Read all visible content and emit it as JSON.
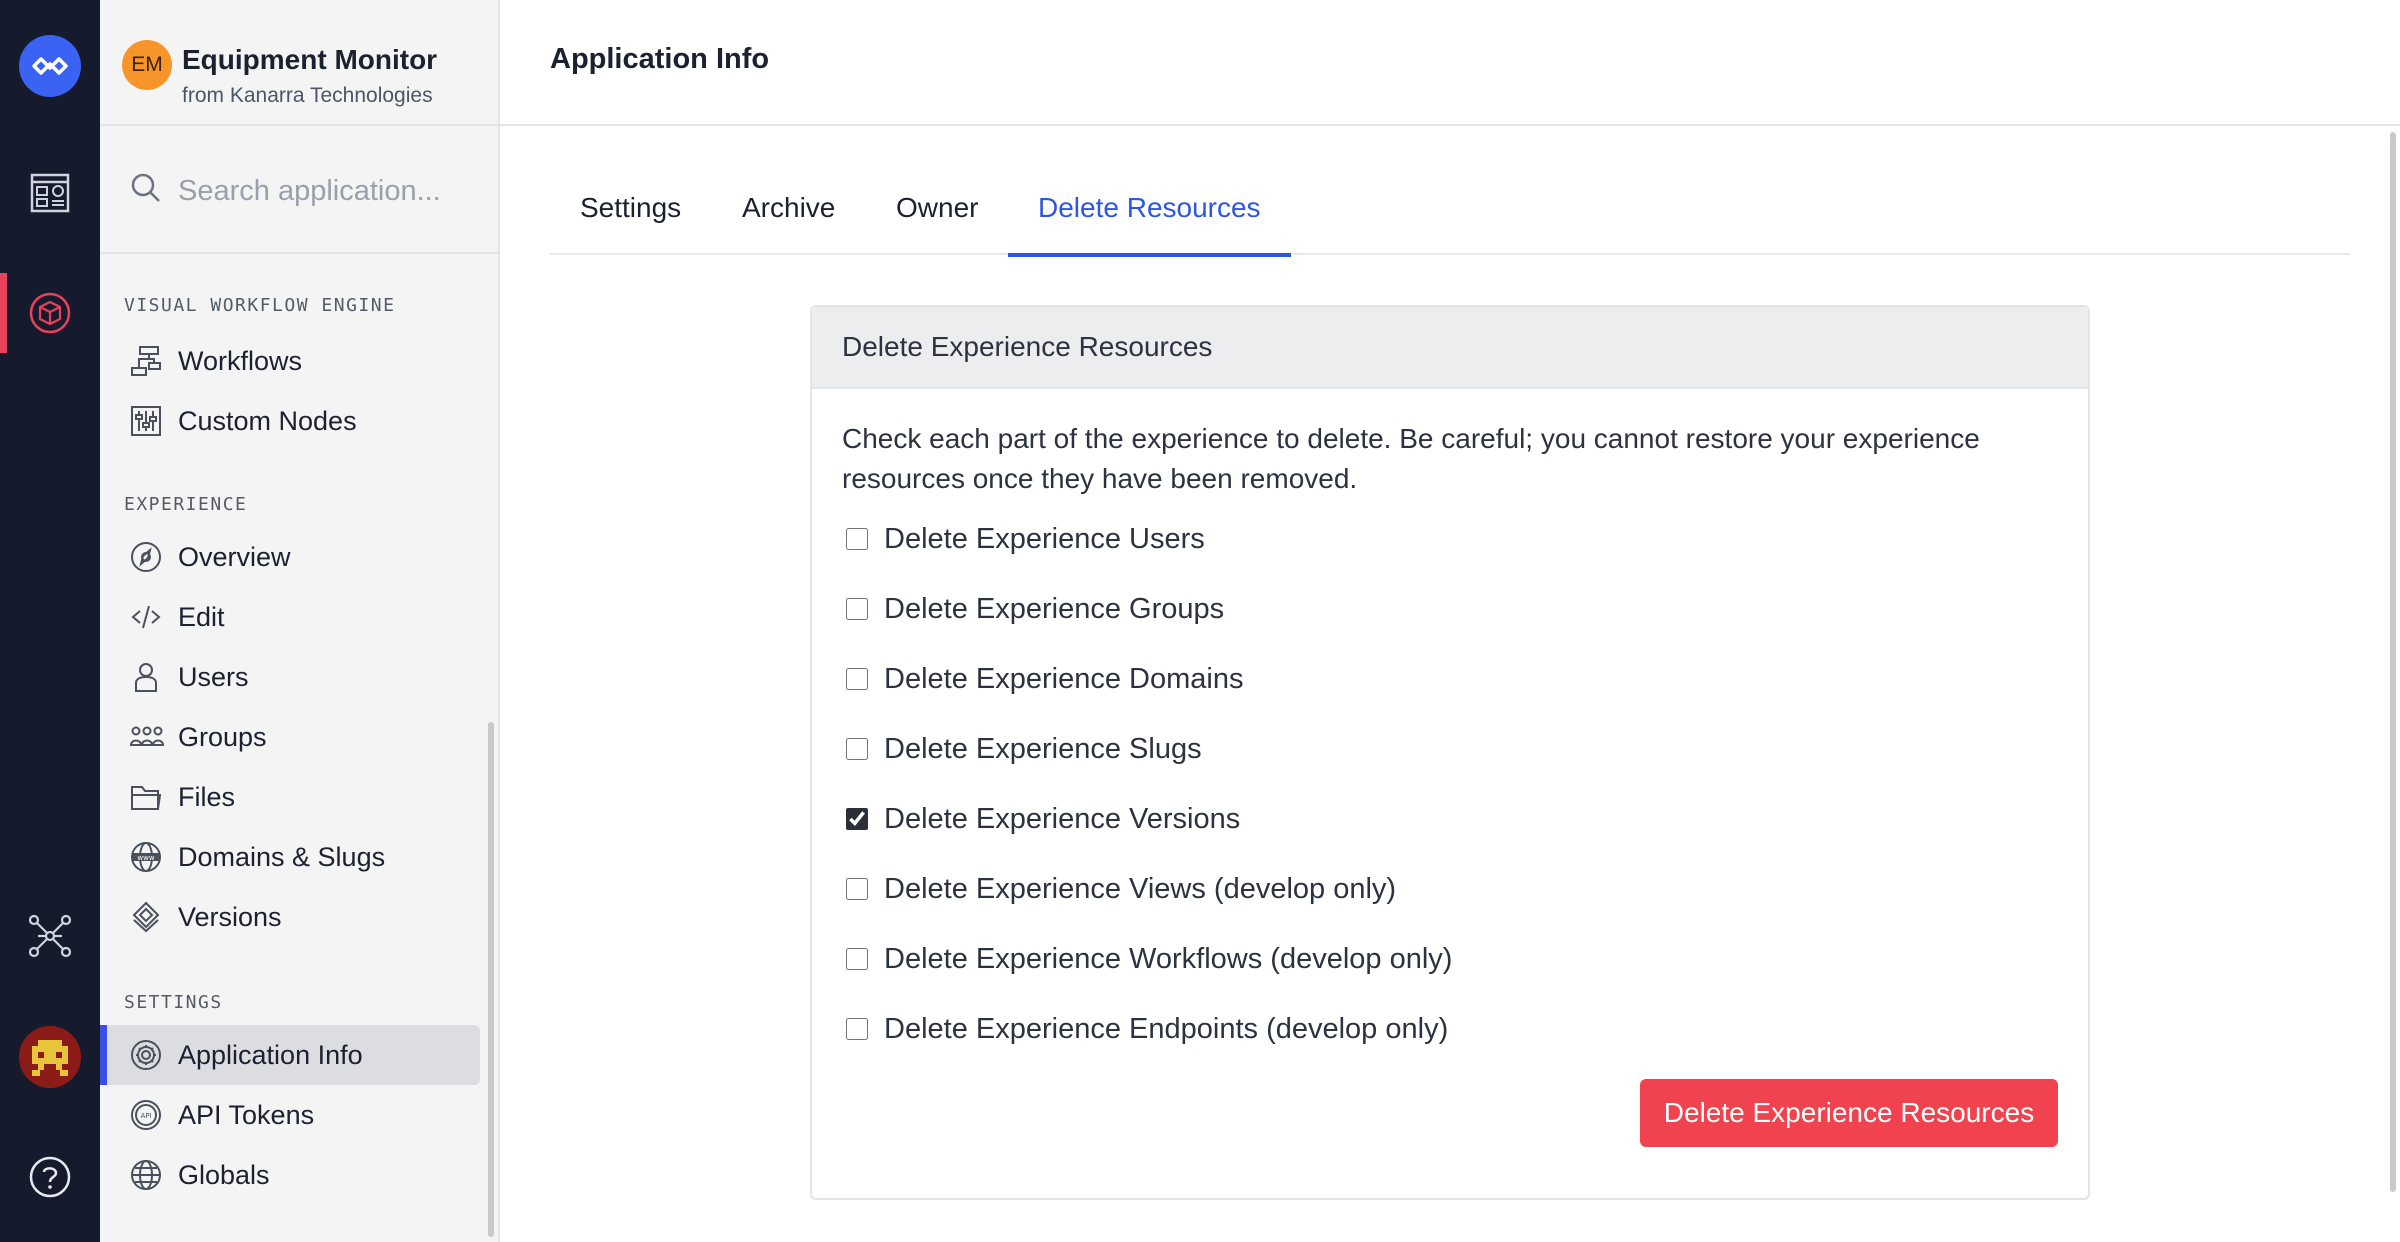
{
  "app": {
    "initials": "EM",
    "name": "Equipment Monitor",
    "owner_line": "from Kanarra Technologies"
  },
  "search": {
    "placeholder": "Search application..."
  },
  "sidebar": {
    "sections": [
      {
        "title": "VISUAL WORKFLOW ENGINE",
        "items": [
          {
            "label": "Workflows",
            "icon": "workflow-icon"
          },
          {
            "label": "Custom Nodes",
            "icon": "sliders-icon"
          }
        ]
      },
      {
        "title": "EXPERIENCE",
        "items": [
          {
            "label": "Overview",
            "icon": "compass-icon"
          },
          {
            "label": "Edit",
            "icon": "code-icon"
          },
          {
            "label": "Users",
            "icon": "user-icon"
          },
          {
            "label": "Groups",
            "icon": "users-group-icon"
          },
          {
            "label": "Files",
            "icon": "folder-icon"
          },
          {
            "label": "Domains & Slugs",
            "icon": "globe-www-icon"
          },
          {
            "label": "Versions",
            "icon": "layers-icon"
          }
        ]
      },
      {
        "title": "SETTINGS",
        "items": [
          {
            "label": "Application Info",
            "icon": "gear-icon",
            "active": true
          },
          {
            "label": "API Tokens",
            "icon": "api-token-icon"
          },
          {
            "label": "Globals",
            "icon": "globe-icon"
          }
        ]
      }
    ]
  },
  "header": {
    "title": "Application Info"
  },
  "tabs": [
    {
      "label": "Settings"
    },
    {
      "label": "Archive"
    },
    {
      "label": "Owner"
    },
    {
      "label": "Delete Resources",
      "active": true
    }
  ],
  "panel": {
    "title": "Delete Experience Resources",
    "description": "Check each part of the experience to delete. Be careful; you cannot restore your experience resources once they have been removed.",
    "options": [
      {
        "label": "Delete Experience Users",
        "checked": false
      },
      {
        "label": "Delete Experience Groups",
        "checked": false
      },
      {
        "label": "Delete Experience Domains",
        "checked": false
      },
      {
        "label": "Delete Experience Slugs",
        "checked": false
      },
      {
        "label": "Delete Experience Versions",
        "checked": true
      },
      {
        "label": "Delete Experience Views (develop only)",
        "checked": false
      },
      {
        "label": "Delete Experience Workflows (develop only)",
        "checked": false
      },
      {
        "label": "Delete Experience Endpoints (develop only)",
        "checked": false
      }
    ],
    "button_label": "Delete Experience Resources"
  },
  "colors": {
    "accent": "#2d57e0",
    "danger": "#f0424f",
    "rail": "#151a2d",
    "rail_active": "#e8415a",
    "badge": "#f7942a"
  }
}
